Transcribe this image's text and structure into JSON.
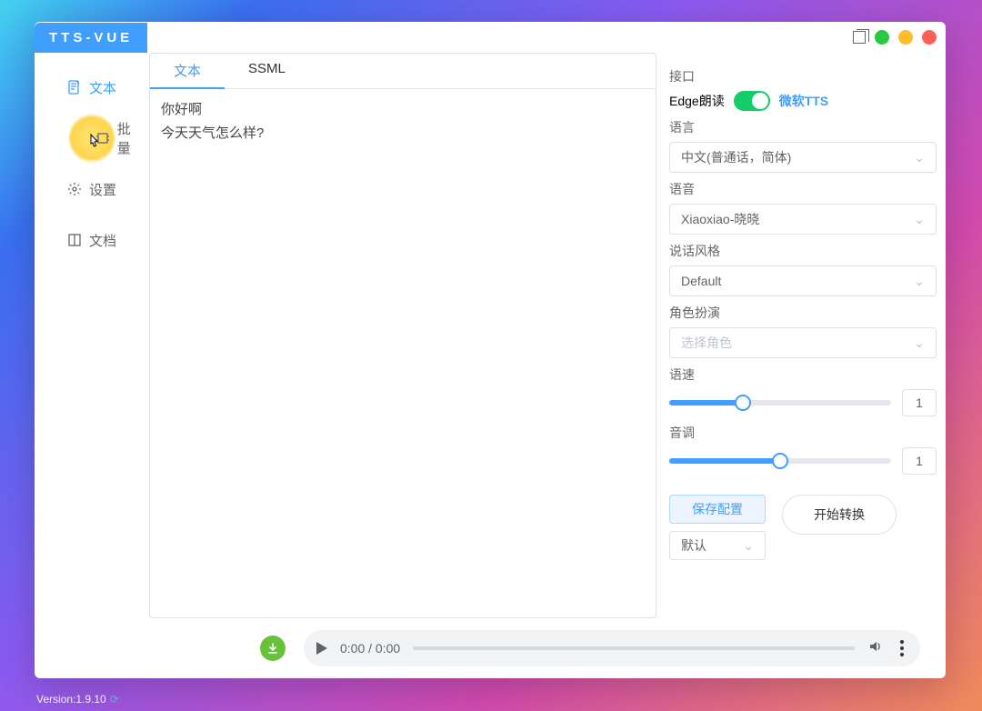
{
  "title": "TTS-VUE",
  "sidebar": {
    "items": [
      {
        "label": "文本"
      },
      {
        "label": "批量"
      },
      {
        "label": "设置"
      },
      {
        "label": "文档"
      }
    ]
  },
  "tabs": {
    "text": "文本",
    "ssml": "SSML"
  },
  "editor": "你好啊\n今天天气怎么样?",
  "panel": {
    "api_label": "接口",
    "edge_label": "Edge朗读",
    "ms_label": "微软TTS",
    "language_label": "语言",
    "language_value": "中文(普通话，简体)",
    "voice_label": "语音",
    "voice_value": "Xiaoxiao-晓晓",
    "style_label": "说话风格",
    "style_value": "Default",
    "role_label": "角色扮演",
    "role_placeholder": "选择角色",
    "speed_label": "语速",
    "speed_value": "1",
    "pitch_label": "音调",
    "pitch_value": "1",
    "save_config": "保存配置",
    "preset_value": "默认",
    "start": "开始转换"
  },
  "player": {
    "time": "0:00 / 0:00"
  },
  "version": "Version:1.9.10"
}
